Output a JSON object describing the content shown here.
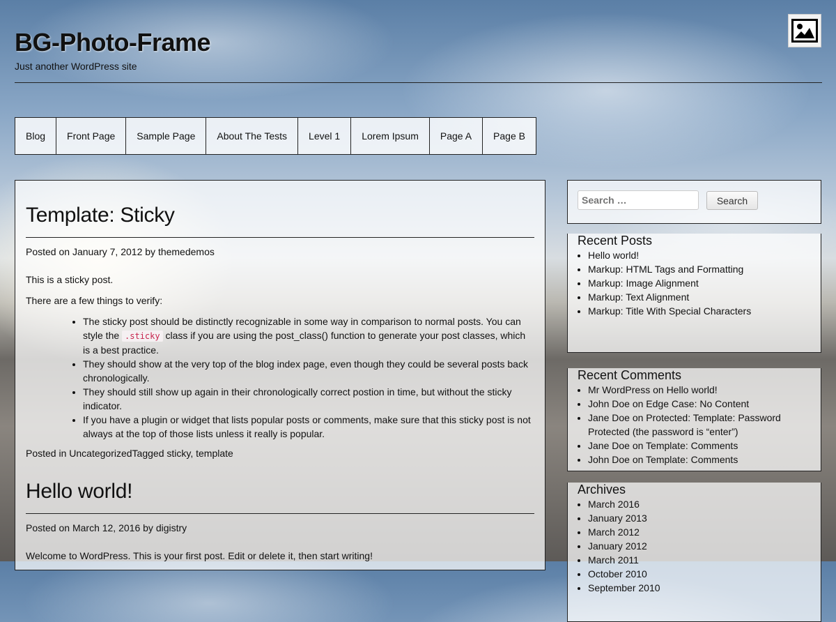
{
  "site": {
    "title": "BG-Photo-Frame",
    "description": "Just another WordPress site"
  },
  "header_image_icon": "image-icon",
  "nav": [
    "Blog",
    "Front Page",
    "Sample Page",
    "About The Tests",
    "Level 1",
    "Lorem Ipsum",
    "Page A",
    "Page B"
  ],
  "posts": [
    {
      "title": "Template: Sticky",
      "posted_on_label": "Posted on",
      "date": "January 7, 2012",
      "by_label": "by",
      "author": "themedemos",
      "intro": "This is a sticky post.",
      "intro2": "There are a few things to verify:",
      "bullet1_pre": "The sticky post should be distinctly recognizable in some way in comparison to normal posts. You can style the",
      "bullet1_code": ".sticky",
      "bullet1_post": "class if you are using the post_class() function to generate your post classes, which is a best practice.",
      "bullet2": "They should show at the very top of the blog index page, even though they could be several posts back chronologically.",
      "bullet3": "They should still show up again in their chronologically correct postion in time, but without the sticky indicator.",
      "bullet4": "If you have a plugin or widget that lists popular posts or comments, make sure that this sticky post is not always at the top of those lists unless it really is popular.",
      "posted_in_label": "Posted in",
      "category": "Uncategorized",
      "tagged_label": "Tagged",
      "tag1": "sticky",
      "tag_sep": ",",
      "tag2": "template"
    },
    {
      "title": "Hello world!",
      "posted_on_label": "Posted on",
      "date": "March 12, 2016",
      "by_label": "by",
      "author": "digistry",
      "intro": "Welcome to WordPress. This is your first post. Edit or delete it, then start writing!"
    }
  ],
  "search": {
    "placeholder": "Search …",
    "button": "Search"
  },
  "recent_posts": {
    "title": "Recent Posts",
    "items": [
      "Hello world!",
      "Markup: HTML Tags and Formatting",
      "Markup: Image Alignment",
      "Markup: Text Alignment",
      "Markup: Title With Special Characters"
    ]
  },
  "recent_comments": {
    "title": "Recent Comments",
    "items": [
      {
        "author": "Mr WordPress",
        "on": "on",
        "post": "Hello world!"
      },
      {
        "author": "John Doe",
        "on": "on",
        "post": "Edge Case: No Content"
      },
      {
        "author": "Jane Doe",
        "on": "on",
        "post": "Protected: Template: Password Protected (the password is “enter”)"
      },
      {
        "author": "Jane Doe",
        "on": "on",
        "post": "Template: Comments"
      },
      {
        "author": "John Doe",
        "on": "on",
        "post": "Template: Comments"
      }
    ]
  },
  "archives": {
    "title": "Archives",
    "items": [
      "March 2016",
      "January 2013",
      "March 2012",
      "January 2012",
      "March 2011",
      "October 2010",
      "September 2010"
    ]
  }
}
